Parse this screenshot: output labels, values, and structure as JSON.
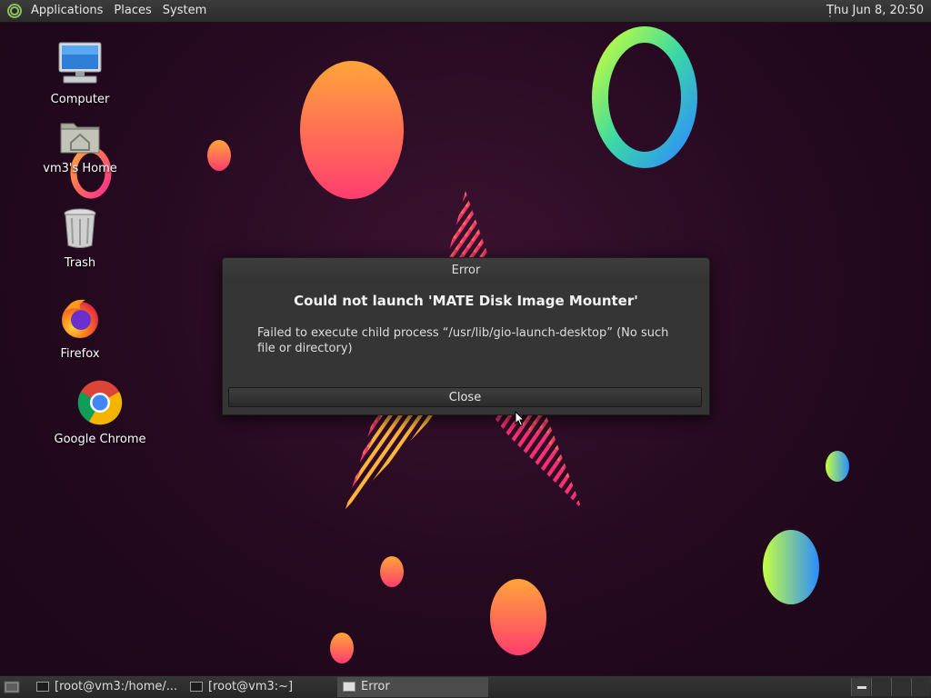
{
  "top_panel": {
    "menus": [
      "Applications",
      "Places",
      "System"
    ],
    "clock": "Thu Jun  8, 20:50"
  },
  "desktop_icons": {
    "computer": "Computer",
    "home": "vm3's Home",
    "trash": "Trash",
    "firefox": "Firefox",
    "chrome": "Google Chrome"
  },
  "dialog": {
    "title": "Error",
    "heading": "Could not launch 'MATE Disk Image Mounter'",
    "message": "Failed to execute child process “/usr/lib/gio-launch-desktop” (No such file or directory)",
    "close_label": "Close"
  },
  "taskbar": {
    "tasks": [
      "[root@vm3:/home/...",
      "[root@vm3:~]",
      "Error"
    ]
  },
  "colors": {
    "panel": "#2b2b2b",
    "dialog_bg": "#353535",
    "desktop_bg": "#24091f"
  }
}
